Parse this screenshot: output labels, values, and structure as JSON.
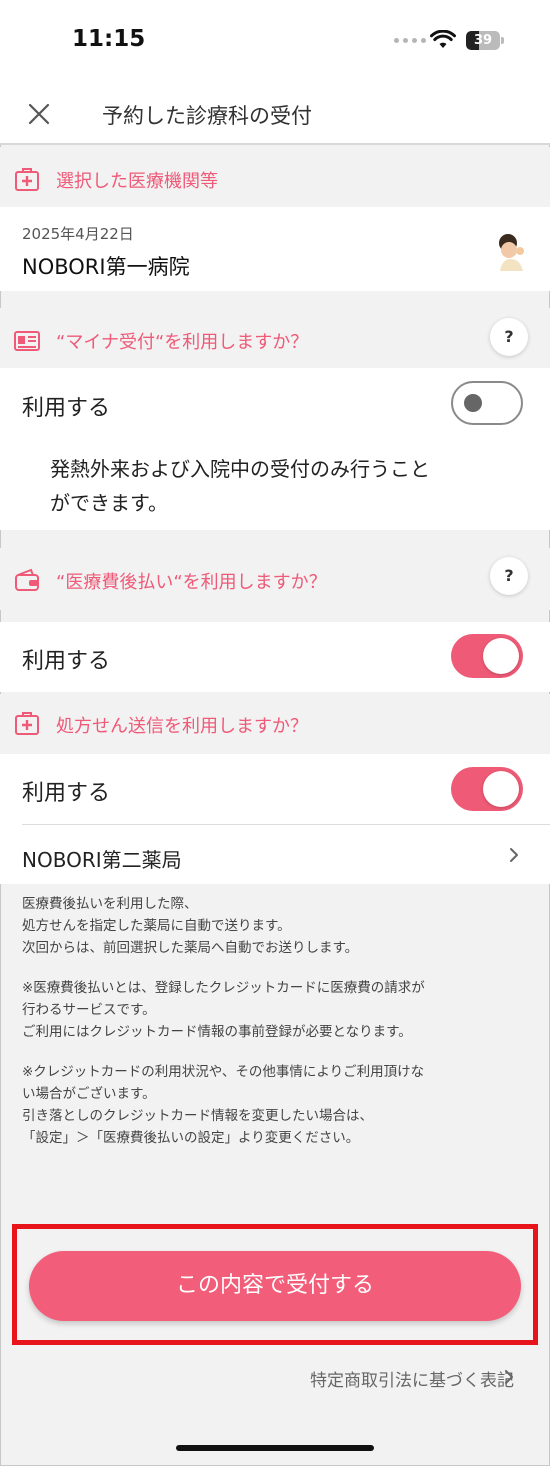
{
  "status_bar": {
    "time": "11:15",
    "battery": "39",
    "battery_level": 0.39
  },
  "header": {
    "title": "予約した診療科の受付"
  },
  "sections": {
    "facility": {
      "title": "選択した医療機関等",
      "date": "2025年4月22日",
      "name": "NOBORI第一病院"
    },
    "myna": {
      "title": "“マイナ受付“を利用しますか？",
      "help": "?",
      "toggle_label": "利用する",
      "toggle_on": false,
      "note_line1": "発熱外来および入院中の受付のみ行うこと",
      "note_line2": "ができます。"
    },
    "deferred_payment": {
      "title": "“医療費後払い“を利用しますか？",
      "help": "?",
      "toggle_label": "利用する",
      "toggle_on": true
    },
    "prescription": {
      "title": "処方せん送信を利用しますか？",
      "toggle_label": "利用する",
      "toggle_on": true,
      "pharmacy": "NOBORI第二薬局"
    }
  },
  "notes": [
    "医療費後払いを利用した際、",
    "処方せんを指定した薬局に自動で送ります。",
    "次回からは、前回選択した薬局へ自動でお送りします。",
    "",
    "※医療費後払いとは、登録したクレジットカードに医療費の請求が",
    "行わるサービスです。",
    "ご利用にはクレジットカード情報の事前登録が必要となります。",
    "",
    "※クレジットカードの利用状況や、その他事情によりご利用頂けな",
    "い場合がございます。",
    "引き落としのクレジットカード情報を変更したい場合は、",
    "「設定」＞「医療費後払いの設定」より変更ください。"
  ],
  "submit_button": "この内容で受付する",
  "legal_link": "特定商取引法に基づく表記",
  "colors": {
    "accent": "#ef5a76",
    "highlight_border": "#e8141c"
  }
}
